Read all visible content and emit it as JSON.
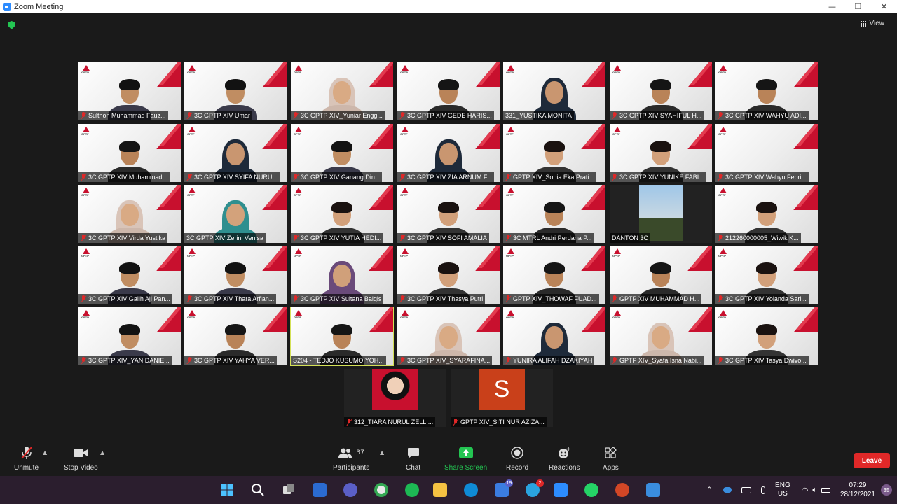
{
  "window": {
    "title": "Zoom Meeting",
    "controls": [
      "—",
      "❐",
      "✕"
    ]
  },
  "header": {
    "view_label": "View"
  },
  "participants": [
    {
      "name": "Sulthon Muhammad Fauz...",
      "muted": true,
      "style": "man-glasses"
    },
    {
      "name": "3C GPTP XIV Umar",
      "muted": true,
      "style": "man-glasses"
    },
    {
      "name": "3C GPTP XIV_Yuniar Engg...",
      "muted": true,
      "style": "hijab-light"
    },
    {
      "name": "3C GPTP XIV GEDE HARIS...",
      "muted": true,
      "style": "man"
    },
    {
      "name": "331_YUSTIKA MONITA",
      "muted": false,
      "style": "hijab-dark"
    },
    {
      "name": "3C GPTP XIV SYAHIFUL H...",
      "muted": true,
      "style": "man"
    },
    {
      "name": "3C GPTP XIV WAHYU ADI...",
      "muted": true,
      "style": "man"
    },
    {
      "name": "3C GPTP XIV Muhammad...",
      "muted": true,
      "style": "man"
    },
    {
      "name": "3C GPTP XIV SYIFA NURU...",
      "muted": true,
      "style": "hijab-dark"
    },
    {
      "name": "3C GPTP XIV Ganang Din...",
      "muted": true,
      "style": "man-glasses"
    },
    {
      "name": "3C GPTP XIV ZIA ARNUM F...",
      "muted": true,
      "style": "hijab-dark"
    },
    {
      "name": "GPTP XIV_Sonia Eka Prati...",
      "muted": true,
      "style": "woman"
    },
    {
      "name": "3C GPTP XIV YUNIKE FABI...",
      "muted": true,
      "style": "woman"
    },
    {
      "name": "3C GPTP XIV Wahyu Febri...",
      "muted": true,
      "style": "empty"
    },
    {
      "name": "3C GPTP XIV Virda Yustika",
      "muted": true,
      "style": "hijab-light"
    },
    {
      "name": "3C GPTP XIV Zerini Venisa",
      "muted": false,
      "style": "hijab-teal"
    },
    {
      "name": "3C GPTP XIV YUTIA HEDI...",
      "muted": true,
      "style": "woman"
    },
    {
      "name": "3C GPTP XIV SOFI AMALIA",
      "muted": true,
      "style": "woman"
    },
    {
      "name": "3C MTRL Andri Perdana P...",
      "muted": true,
      "style": "man"
    },
    {
      "name": "DANTON 3C",
      "muted": false,
      "style": "photo"
    },
    {
      "name": "212260000005_Wiwik K...",
      "muted": true,
      "style": "woman"
    },
    {
      "name": "3C GPTP XIV Galih Aji Pan...",
      "muted": true,
      "style": "man-glasses"
    },
    {
      "name": "3C GPTP XIV Thara Arfian...",
      "muted": true,
      "style": "man-glasses"
    },
    {
      "name": "3C GPTP XIV Sultana Balqis",
      "muted": true,
      "style": "hijab-purple"
    },
    {
      "name": "3C GPTP XIV Thasya Putri",
      "muted": true,
      "style": "woman"
    },
    {
      "name": "GPTP XIV_THOWAF FUAD...",
      "muted": true,
      "style": "man"
    },
    {
      "name": "GPTP XIV MUHAMMAD H...",
      "muted": true,
      "style": "man"
    },
    {
      "name": "3C GPTP XIV Yolanda Sari...",
      "muted": true,
      "style": "woman"
    },
    {
      "name": "3C GPTP XIV_YAN DANIE...",
      "muted": true,
      "style": "man-glasses"
    },
    {
      "name": "3C GPTP XIV YAHYA VER...",
      "muted": true,
      "style": "man"
    },
    {
      "name": "S204 - TEDJO KUSUMO YOH...",
      "muted": false,
      "style": "man",
      "active": true
    },
    {
      "name": "3C GPTP XIV_SYARAFINA...",
      "muted": true,
      "style": "hijab-light"
    },
    {
      "name": "YUNIRA ALIFAH DZAKIYAH",
      "muted": true,
      "style": "hijab-dark"
    },
    {
      "name": "GPTP XIV_Syafa Isna Nabi...",
      "muted": true,
      "style": "hijab-light"
    },
    {
      "name": "3C GPTP XIV Tasya Dwivo...",
      "muted": true,
      "style": "woman"
    },
    {
      "name": "312_TIARA NURUL ZELLI...",
      "muted": true,
      "style": "red-photo"
    },
    {
      "name": "GPTP XIV_SITI NUR AZIZA...",
      "muted": true,
      "style": "initial",
      "initial": "S"
    }
  ],
  "toolbar": {
    "unmute": "Unmute",
    "stop_video": "Stop Video",
    "participants": "Participants",
    "participants_count": "37",
    "chat": "Chat",
    "share_screen": "Share Screen",
    "record": "Record",
    "reactions": "Reactions",
    "apps": "Apps",
    "leave": "Leave"
  },
  "taskbar": {
    "badges": {
      "app1": "19",
      "telegram": "2"
    },
    "language": "ENG",
    "region": "US",
    "time": "07:29",
    "date": "28/12/2021",
    "notifications": "35"
  },
  "colors": {
    "brand_red": "#c8102e",
    "share_green": "#23c552",
    "leave_red": "#e02828",
    "active_outline": "#d4e157"
  }
}
